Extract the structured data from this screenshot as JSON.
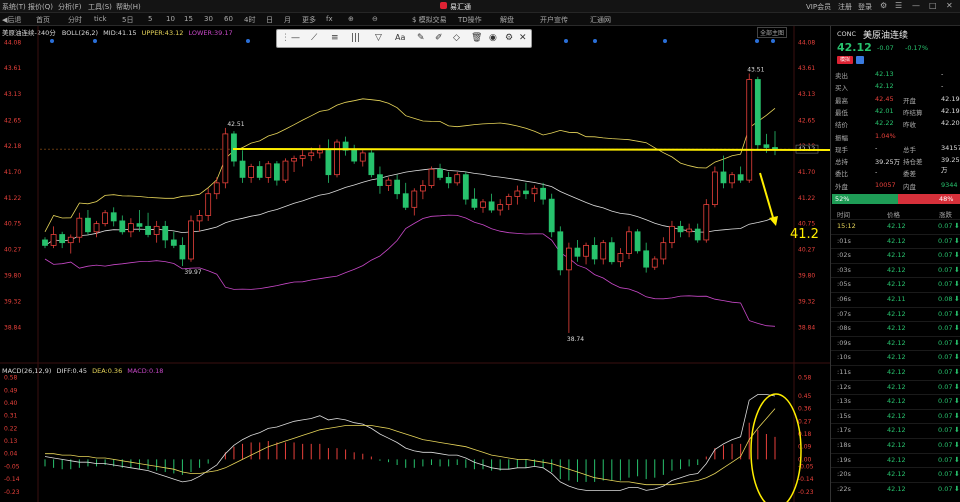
{
  "menu": {
    "items": [
      "系统(T)",
      "报价(Q)",
      "分析(F)",
      "工具(S)",
      "帮助(H)"
    ],
    "app_title": "易汇通",
    "right": [
      "VIP会员",
      "注册",
      "登录"
    ]
  },
  "toolbar": {
    "items": [
      "◀后退",
      "首页",
      "分时",
      "tick",
      "5日",
      "5",
      "10",
      "15",
      "30",
      "60",
      "4时",
      "日",
      "月",
      "更多",
      "fx",
      "$ 模拟交易",
      "TD操作",
      "解盘",
      "开户宣传",
      "汇通网"
    ]
  },
  "chart": {
    "instrument_info": "美原油连续-240分",
    "boll": {
      "label": "BOLL(26,2)",
      "mid": "MID:41.15",
      "upper": "UPPER:43.12",
      "lower": "LOWER:39.17"
    },
    "macd": {
      "label": "MACD(26,12,9)",
      "diff": "DIFF:0.45",
      "dea": "DEA:0.36",
      "macd": "MACD:0.18"
    },
    "y_axis_main": [
      "44.08",
      "43.61",
      "43.13",
      "42.65",
      "42.18",
      "41.70",
      "41.22",
      "40.75",
      "40.27",
      "39.80",
      "39.32",
      "38.84"
    ],
    "y_axis_right": [
      "44.08",
      "43.61",
      "43.13",
      "42.65",
      "42.19",
      "41.70",
      "41.22",
      "40.75",
      "40.27",
      "39.80",
      "39.32",
      "38.84"
    ],
    "right_price_tag": "42.12",
    "annotations": {
      "high_left": "42.51",
      "high_right": "43.51",
      "low_mid": "38.74",
      "low_left": "39.97",
      "target": "41.2"
    },
    "macd_y_axis": [
      "0.58",
      "0.49",
      "0.40",
      "0.31",
      "0.22",
      "0.13",
      "0.04",
      "-0.05",
      "-0.14",
      "-0.23"
    ],
    "macd_right_axis": [
      "0.58",
      "0.45",
      "0.36",
      "0.27",
      "0.18",
      "0.09",
      "0.00",
      "-0.05",
      "-0.14",
      "-0.23"
    ],
    "top_button": "全部主图"
  },
  "drawing_toolbar": {
    "font_label": "Aa"
  },
  "sidebar": {
    "code": "CONC",
    "name": "美原油连续",
    "price": "42.12",
    "change": "-0.07",
    "pct": "-0.17%",
    "badge1": "模拟",
    "quote_rows": [
      {
        "l1": "卖出",
        "v1": "42.13",
        "l2": "",
        "v2": "-"
      },
      {
        "l1": "买入",
        "v1": "42.12",
        "l2": "",
        "v2": "-"
      },
      {
        "l1": "最高",
        "v1": "42.45",
        "l2": "开盘",
        "v2": "42.19"
      },
      {
        "l1": "最低",
        "v1": "42.01",
        "l2": "昨结算",
        "v2": "42.19"
      },
      {
        "l1": "结价",
        "v1": "42.22",
        "l2": "昨收",
        "v2": "42.20"
      },
      {
        "l1": "振幅",
        "v1": "1.04%",
        "l2": "",
        "v2": ""
      },
      {
        "l1": "现手",
        "v1": "-",
        "l2": "总手",
        "v2": "34157"
      },
      {
        "l1": "总持",
        "v1": "39.25万",
        "l2": "持仓差",
        "v2": "39.25万"
      },
      {
        "l1": "委比",
        "v1": "-",
        "l2": "委差",
        "v2": "-"
      },
      {
        "l1": "外盘",
        "v1": "10057",
        "l2": "内盘",
        "v2": "9344"
      }
    ],
    "buy_pct": "52%",
    "sell_pct": "48%",
    "ticks_header": [
      "时间",
      "价格",
      "涨跌"
    ],
    "ticks": [
      {
        "t": "15:12",
        "p": "42.12",
        "c": "0.07"
      },
      {
        "t": ":01s",
        "p": "42.12",
        "c": "0.07"
      },
      {
        "t": ":02s",
        "p": "42.12",
        "c": "0.07"
      },
      {
        "t": ":03s",
        "p": "42.12",
        "c": "0.07"
      },
      {
        "t": ":05s",
        "p": "42.12",
        "c": "0.07"
      },
      {
        "t": ":06s",
        "p": "42.11",
        "c": "0.08"
      },
      {
        "t": ":07s",
        "p": "42.12",
        "c": "0.07"
      },
      {
        "t": ":08s",
        "p": "42.12",
        "c": "0.07"
      },
      {
        "t": ":09s",
        "p": "42.12",
        "c": "0.07"
      },
      {
        "t": ":10s",
        "p": "42.12",
        "c": "0.07"
      },
      {
        "t": ":11s",
        "p": "42.12",
        "c": "0.07"
      },
      {
        "t": ":12s",
        "p": "42.12",
        "c": "0.07"
      },
      {
        "t": ":13s",
        "p": "42.12",
        "c": "0.07"
      },
      {
        "t": ":15s",
        "p": "42.12",
        "c": "0.07"
      },
      {
        "t": ":17s",
        "p": "42.12",
        "c": "0.07"
      },
      {
        "t": ":18s",
        "p": "42.12",
        "c": "0.07"
      },
      {
        "t": ":19s",
        "p": "42.12",
        "c": "0.07"
      },
      {
        "t": ":20s",
        "p": "42.12",
        "c": "0.07"
      },
      {
        "t": ":22s",
        "p": "42.12",
        "c": "0.07"
      }
    ]
  },
  "colors": {
    "up": "#e8413b",
    "down": "#27c26d",
    "annotation": "#ffee00",
    "mid": "#dddddd",
    "upper": "#e8d65a",
    "lower": "#c848c8"
  },
  "chart_data": {
    "type": "candlestick",
    "price_range": [
      38.5,
      44.2
    ],
    "candles": [
      [
        40.45,
        40.5,
        40.3,
        40.35
      ],
      [
        40.35,
        40.7,
        40.3,
        40.55
      ],
      [
        40.55,
        40.6,
        40.3,
        40.4
      ],
      [
        40.4,
        40.55,
        40.2,
        40.5
      ],
      [
        40.5,
        40.95,
        40.4,
        40.85
      ],
      [
        40.85,
        41.0,
        40.55,
        40.6
      ],
      [
        40.6,
        40.8,
        40.5,
        40.75
      ],
      [
        40.75,
        41.0,
        40.7,
        40.95
      ],
      [
        40.95,
        41.05,
        40.7,
        40.8
      ],
      [
        40.8,
        40.9,
        40.55,
        40.6
      ],
      [
        40.6,
        40.85,
        40.5,
        40.75
      ],
      [
        40.75,
        41.0,
        40.6,
        40.7
      ],
      [
        40.7,
        40.95,
        40.5,
        40.55
      ],
      [
        40.55,
        40.8,
        40.4,
        40.7
      ],
      [
        40.7,
        40.8,
        40.3,
        40.45
      ],
      [
        40.45,
        40.6,
        40.3,
        40.35
      ],
      [
        40.35,
        40.5,
        39.97,
        40.1
      ],
      [
        40.1,
        40.9,
        40.05,
        40.8
      ],
      [
        40.8,
        41.0,
        40.6,
        40.9
      ],
      [
        40.9,
        41.4,
        40.8,
        41.3
      ],
      [
        41.3,
        41.6,
        41.2,
        41.5
      ],
      [
        41.5,
        42.51,
        41.4,
        42.4
      ],
      [
        42.4,
        42.45,
        41.8,
        41.9
      ],
      [
        41.9,
        42.1,
        41.5,
        41.6
      ],
      [
        41.6,
        41.85,
        41.5,
        41.8
      ],
      [
        41.8,
        41.9,
        41.55,
        41.6
      ],
      [
        41.6,
        41.9,
        41.5,
        41.85
      ],
      [
        41.85,
        41.9,
        41.45,
        41.55
      ],
      [
        41.55,
        41.95,
        41.5,
        41.9
      ],
      [
        41.9,
        42.0,
        41.7,
        41.95
      ],
      [
        41.95,
        42.1,
        41.8,
        42.0
      ],
      [
        42.0,
        42.15,
        41.9,
        42.05
      ],
      [
        42.05,
        42.2,
        41.95,
        42.1
      ],
      [
        42.1,
        42.3,
        41.5,
        41.65
      ],
      [
        41.65,
        42.3,
        41.6,
        42.25
      ],
      [
        42.25,
        42.35,
        42.0,
        42.1
      ],
      [
        42.1,
        42.2,
        41.85,
        41.9
      ],
      [
        41.9,
        42.1,
        41.8,
        42.05
      ],
      [
        42.05,
        42.1,
        41.6,
        41.65
      ],
      [
        41.65,
        41.8,
        41.3,
        41.45
      ],
      [
        41.45,
        41.6,
        41.35,
        41.55
      ],
      [
        41.55,
        41.65,
        41.2,
        41.3
      ],
      [
        41.3,
        41.5,
        41.0,
        41.05
      ],
      [
        41.05,
        41.4,
        40.9,
        41.35
      ],
      [
        41.35,
        41.55,
        41.2,
        41.45
      ],
      [
        41.45,
        41.8,
        41.4,
        41.75
      ],
      [
        41.75,
        41.85,
        41.55,
        41.6
      ],
      [
        41.6,
        41.7,
        41.4,
        41.5
      ],
      [
        41.5,
        41.7,
        41.45,
        41.65
      ],
      [
        41.65,
        41.7,
        41.1,
        41.2
      ],
      [
        41.2,
        41.4,
        41.0,
        41.05
      ],
      [
        41.05,
        41.2,
        40.95,
        41.15
      ],
      [
        41.15,
        41.3,
        40.95,
        41.0
      ],
      [
        41.0,
        41.2,
        40.9,
        41.1
      ],
      [
        41.1,
        41.3,
        41.0,
        41.25
      ],
      [
        41.25,
        41.45,
        41.1,
        41.35
      ],
      [
        41.35,
        41.5,
        41.2,
        41.3
      ],
      [
        41.3,
        41.45,
        41.15,
        41.4
      ],
      [
        41.4,
        41.5,
        41.1,
        41.2
      ],
      [
        41.2,
        41.3,
        40.5,
        40.6
      ],
      [
        40.6,
        40.7,
        39.8,
        39.9
      ],
      [
        39.9,
        40.4,
        38.74,
        40.3
      ],
      [
        40.3,
        40.45,
        40.05,
        40.15
      ],
      [
        40.15,
        40.4,
        40.0,
        40.35
      ],
      [
        40.35,
        40.5,
        40.0,
        40.1
      ],
      [
        40.1,
        40.45,
        40.0,
        40.4
      ],
      [
        40.4,
        40.5,
        40.0,
        40.05
      ],
      [
        40.05,
        40.3,
        39.95,
        40.2
      ],
      [
        40.2,
        40.7,
        40.1,
        40.6
      ],
      [
        40.6,
        40.65,
        40.2,
        40.25
      ],
      [
        40.25,
        40.4,
        39.85,
        39.95
      ],
      [
        39.95,
        40.15,
        39.9,
        40.1
      ],
      [
        40.1,
        40.5,
        40.0,
        40.4
      ],
      [
        40.4,
        40.8,
        40.3,
        40.7
      ],
      [
        40.7,
        40.8,
        40.5,
        40.6
      ],
      [
        40.6,
        40.75,
        40.5,
        40.65
      ],
      [
        40.65,
        40.75,
        40.4,
        40.45
      ],
      [
        40.45,
        41.2,
        40.4,
        41.1
      ],
      [
        41.1,
        41.8,
        41.05,
        41.7
      ],
      [
        41.7,
        42.0,
        41.4,
        41.5
      ],
      [
        41.5,
        41.7,
        41.4,
        41.65
      ],
      [
        41.65,
        41.8,
        41.5,
        41.55
      ],
      [
        41.55,
        43.51,
        41.5,
        43.4
      ],
      [
        43.4,
        43.45,
        42.1,
        42.2
      ],
      [
        42.2,
        42.4,
        42.05,
        42.15
      ],
      [
        42.15,
        42.45,
        42.01,
        42.12
      ]
    ],
    "macd_hist": [
      -0.05,
      -0.06,
      -0.07,
      -0.07,
      -0.06,
      -0.05,
      -0.05,
      -0.04,
      -0.05,
      -0.06,
      -0.06,
      -0.07,
      -0.07,
      -0.08,
      -0.09,
      -0.1,
      -0.11,
      -0.09,
      -0.06,
      -0.03,
      0.0,
      0.05,
      0.09,
      0.11,
      0.12,
      0.12,
      0.13,
      0.12,
      0.12,
      0.12,
      0.11,
      0.11,
      0.11,
      0.08,
      0.08,
      0.07,
      0.05,
      0.04,
      0.02,
      -0.01,
      -0.02,
      -0.04,
      -0.06,
      -0.06,
      -0.05,
      -0.04,
      -0.05,
      -0.05,
      -0.04,
      -0.06,
      -0.07,
      -0.07,
      -0.08,
      -0.08,
      -0.07,
      -0.06,
      -0.06,
      -0.05,
      -0.06,
      -0.09,
      -0.14,
      -0.15,
      -0.16,
      -0.16,
      -0.16,
      -0.15,
      -0.15,
      -0.15,
      -0.13,
      -0.12,
      -0.14,
      -0.13,
      -0.11,
      -0.08,
      -0.07,
      -0.05,
      -0.04,
      0.02,
      0.08,
      0.1,
      0.11,
      0.11,
      0.26,
      0.21,
      0.18,
      0.16
    ],
    "diff": [
      0.02,
      0.01,
      0.0,
      -0.01,
      -0.02,
      -0.02,
      -0.03,
      -0.03,
      -0.04,
      -0.05,
      -0.06,
      -0.07,
      -0.08,
      -0.1,
      -0.12,
      -0.14,
      -0.16,
      -0.15,
      -0.12,
      -0.08,
      -0.04,
      0.04,
      0.1,
      0.14,
      0.17,
      0.19,
      0.22,
      0.23,
      0.25,
      0.27,
      0.28,
      0.29,
      0.31,
      0.28,
      0.29,
      0.28,
      0.26,
      0.25,
      0.22,
      0.18,
      0.15,
      0.12,
      0.08,
      0.06,
      0.05,
      0.05,
      0.04,
      0.03,
      0.03,
      0.01,
      -0.02,
      -0.04,
      -0.06,
      -0.07,
      -0.07,
      -0.06,
      -0.06,
      -0.05,
      -0.06,
      -0.1,
      -0.16,
      -0.19,
      -0.21,
      -0.22,
      -0.22,
      -0.22,
      -0.22,
      -0.22,
      -0.2,
      -0.2,
      -0.22,
      -0.21,
      -0.19,
      -0.15,
      -0.13,
      -0.11,
      -0.1,
      -0.03,
      0.07,
      0.11,
      0.14,
      0.16,
      0.42,
      0.46,
      0.46,
      0.45
    ],
    "dea": [
      0.04,
      0.04,
      0.03,
      0.03,
      0.02,
      0.02,
      0.01,
      0.01,
      0.0,
      -0.01,
      -0.02,
      -0.03,
      -0.04,
      -0.05,
      -0.06,
      -0.07,
      -0.09,
      -0.1,
      -0.1,
      -0.09,
      -0.08,
      -0.06,
      -0.03,
      0.0,
      0.03,
      0.06,
      0.09,
      0.11,
      0.13,
      0.15,
      0.17,
      0.19,
      0.21,
      0.22,
      0.23,
      0.24,
      0.24,
      0.24,
      0.24,
      0.23,
      0.22,
      0.2,
      0.18,
      0.16,
      0.14,
      0.13,
      0.12,
      0.11,
      0.1,
      0.09,
      0.07,
      0.05,
      0.03,
      0.02,
      0.01,
      0.0,
      0.0,
      -0.01,
      -0.02,
      -0.03,
      -0.05,
      -0.07,
      -0.09,
      -0.11,
      -0.13,
      -0.14,
      -0.15,
      -0.16,
      -0.16,
      -0.17,
      -0.18,
      -0.18,
      -0.18,
      -0.18,
      -0.17,
      -0.16,
      -0.15,
      -0.13,
      -0.1,
      -0.06,
      -0.02,
      0.02,
      0.14,
      0.22,
      0.29,
      0.36
    ]
  }
}
